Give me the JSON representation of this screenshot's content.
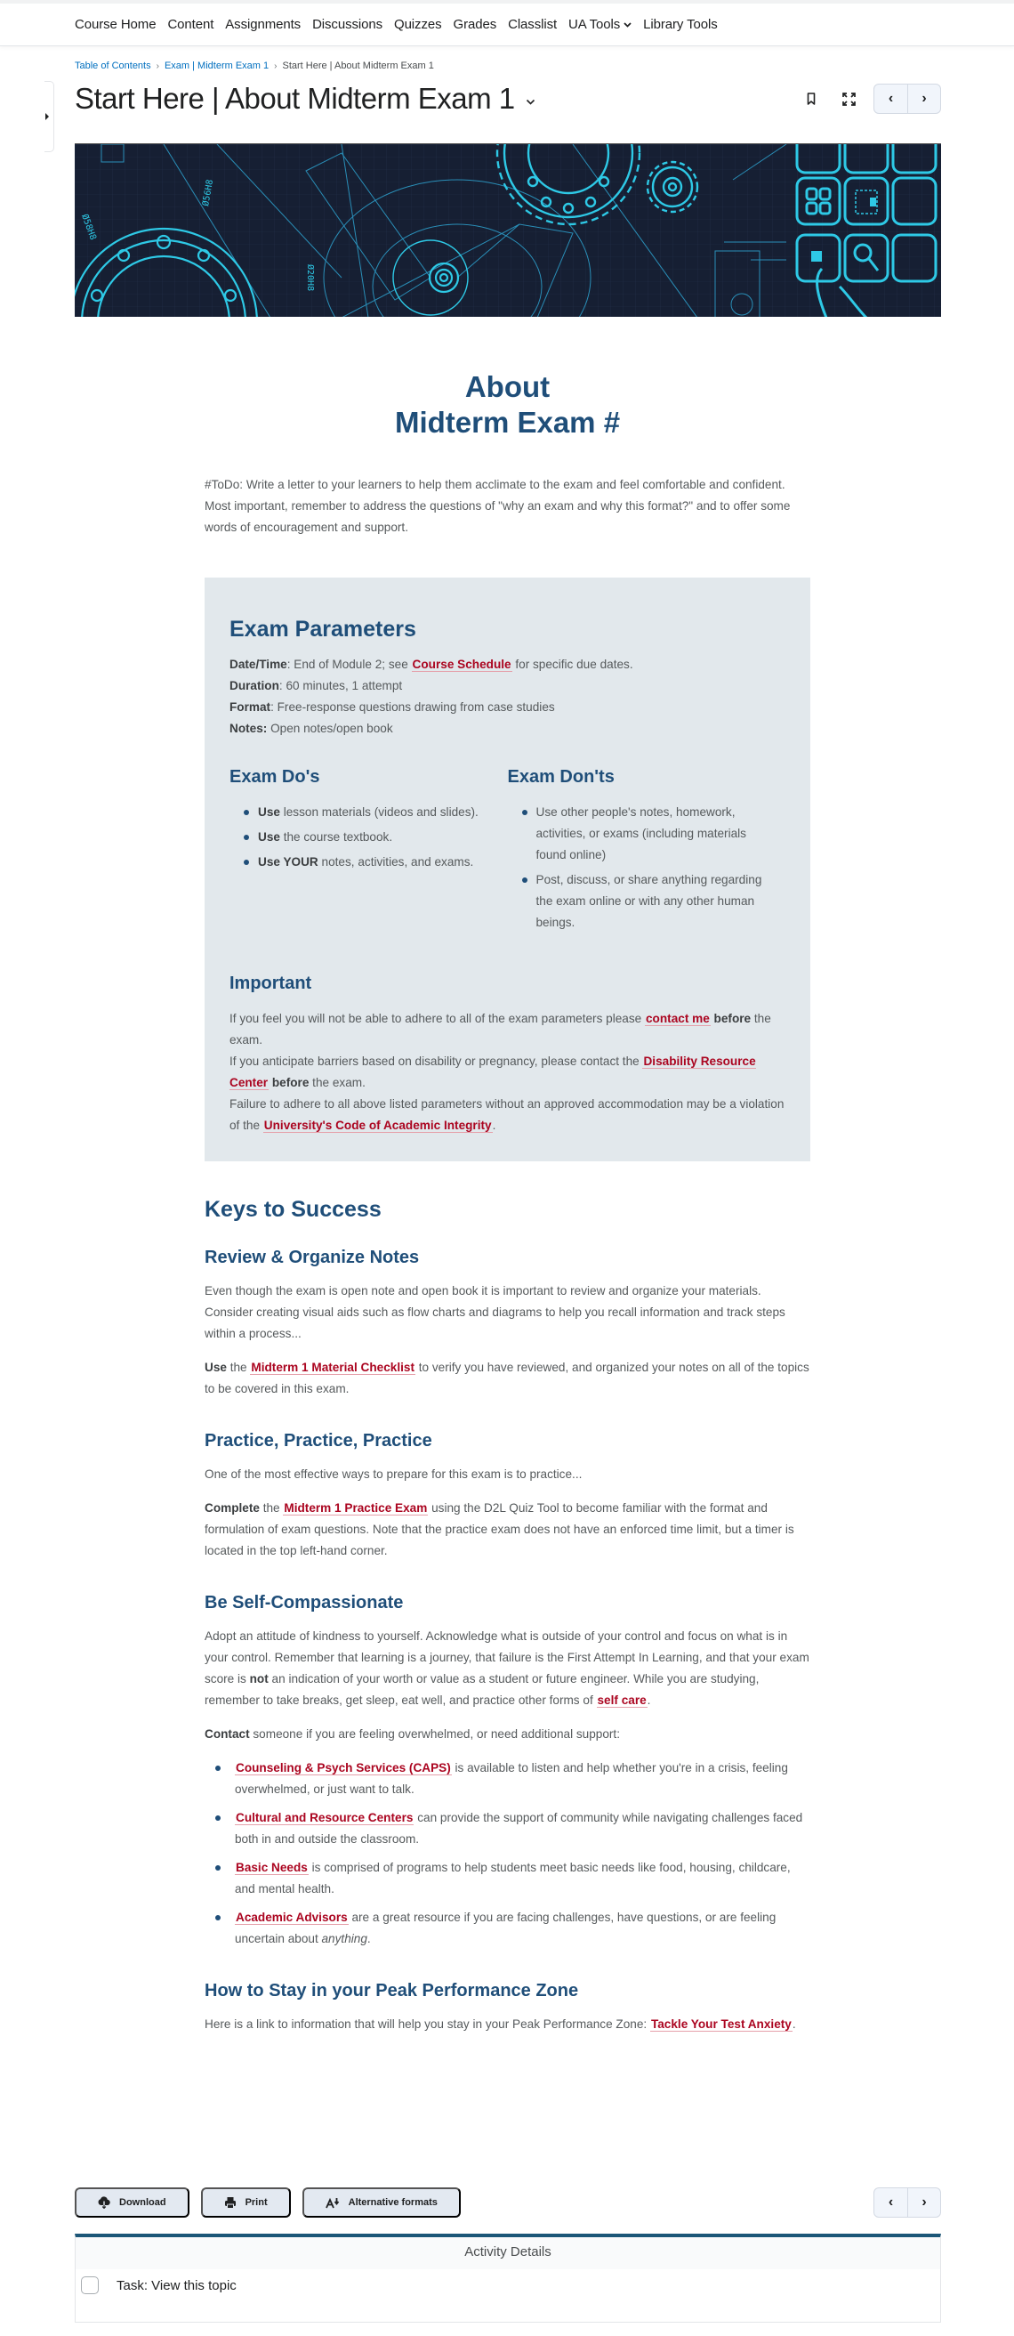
{
  "nav": {
    "items": [
      {
        "label": "Course Home"
      },
      {
        "label": "Content"
      },
      {
        "label": "Assignments"
      },
      {
        "label": "Discussions"
      },
      {
        "label": "Quizzes"
      },
      {
        "label": "Grades"
      },
      {
        "label": "Classlist"
      },
      {
        "label": "UA Tools",
        "has_dropdown": true
      },
      {
        "label": "Library Tools"
      }
    ]
  },
  "breadcrumb": {
    "items": [
      "Table of Contents",
      "Exam | Midterm Exam 1"
    ],
    "current": "Start Here | About Midterm Exam 1",
    "separator": "›"
  },
  "page": {
    "title": "Start Here | About Midterm Exam 1",
    "actions": {
      "bookmark_icon": "bookmark-icon",
      "fullscreen_icon": "expand-icon",
      "prev": "‹",
      "next": "›"
    }
  },
  "banner": {
    "description": "blueprint engineering illustration with gears and cyan icon tiles",
    "colors": {
      "background": "#161f33",
      "line": "#2ec9e6"
    },
    "labels": [
      "Ø58H8",
      "Ø56H8",
      "Ø20H8"
    ]
  },
  "article": {
    "hero_line1": "About",
    "hero_line2": "Midterm Exam #",
    "intro": "#ToDo: Write a letter to your learners to help them acclimate to the exam and feel comfortable and confident. Most important, remember to address the questions of \"why an exam and why this format?\" and to offer some words of encouragement and support.",
    "params": {
      "heading": "Exam Parameters",
      "datetime_label": "Date/Time",
      "datetime_pre": ": End of Module 2; see ",
      "datetime_link": "Course Schedule",
      "datetime_post": " for specific due dates.",
      "duration_label": "Duration",
      "duration_value": ": 60 minutes, 1 attempt",
      "format_label": "Format",
      "format_value": ": Free-response questions drawing from case studies",
      "notes_label": "Notes:",
      "notes_value": " Open notes/open book"
    },
    "dos": {
      "heading": "Exam Do's",
      "items": [
        {
          "bold": "Use",
          "text": " lesson materials (videos and slides)."
        },
        {
          "bold": "Use",
          "text": " the course textbook."
        },
        {
          "bold": "Use YOUR",
          "text": " notes, activities, and exams."
        }
      ]
    },
    "donts": {
      "heading": "Exam Don'ts",
      "items": [
        "Use other people's notes, homework, activities, or exams (including materials found online)",
        "Post, discuss, or share anything regarding the exam online or with any other human beings."
      ]
    },
    "important": {
      "heading": "Important",
      "line1_pre": "If you feel you will not be able to adhere to all of the exam parameters please ",
      "line1_link": "contact me",
      "line1_bold": "before",
      "line1_post": " the exam.",
      "line2_pre": "If you anticipate barriers based on disability or pregnancy, please contact the ",
      "line2_link": "Disability Resource Center",
      "line2_bold": "before",
      "line2_post": " the exam.",
      "line3_pre": "Failure to adhere to all above listed parameters without an approved accommodation may be a violation of the ",
      "line3_link": "University's Code of Academic Integrity",
      "line3_post": "."
    },
    "keys": {
      "heading": "Keys to Success",
      "review": {
        "heading": "Review & Organize Notes",
        "para": "Even though the exam is open note and open book it is important to review and organize your materials. Consider creating visual aids such as flow charts and diagrams to help you recall information and track steps within a process...",
        "use_bold": "Use",
        "use_pre": " the ",
        "use_link": "Midterm 1 Material Checklist",
        "use_post": " to verify you have reviewed, and organized your notes on all of the topics to be covered in this exam."
      },
      "practice": {
        "heading": "Practice, Practice, Practice",
        "para": "One of the most effective ways to prepare for this exam is to practice...",
        "complete_bold": "Complete",
        "complete_pre": " the ",
        "complete_link": "Midterm 1 Practice Exam",
        "complete_post": " using the D2L Quiz Tool to become familiar with the format and formulation of exam questions. Note that the practice exam does not have an enforced time limit, but a timer is located in the top left-hand corner."
      },
      "self": {
        "heading": "Be Self-Compassionate",
        "para_pre": "Adopt an attitude of kindness to yourself. Acknowledge what is outside of your control and focus on what is in your control. Remember that learning is a journey, that failure is the First Attempt In Learning, and that your exam score is ",
        "para_bold": "not",
        "para_mid": " an indication of your worth or value as a student or future engineer. While you are studying, remember to take breaks, get sleep, eat well, and practice other forms of ",
        "para_link": "self care",
        "para_post": ".",
        "contact_bold": "Contact",
        "contact_text": " someone if you are feeling overwhelmed, or need additional support:",
        "support": [
          {
            "link": "Counseling & Psych Services (CAPS)",
            "text": " is available to listen and help whether you're in a crisis, feeling overwhelmed, or just want to talk."
          },
          {
            "link": "Cultural and Resource Centers",
            "text": " can provide the support of community while navigating challenges faced both in and outside the classroom."
          },
          {
            "link": "Basic Needs",
            "text": " is comprised of programs to help students meet basic needs like food, housing, childcare, and mental health."
          },
          {
            "link": "Academic Advisors",
            "text": " are a great resource if you are facing challenges, have questions, or are feeling uncertain about ",
            "italic": "anything",
            "end": "."
          }
        ]
      },
      "peak": {
        "heading": "How to Stay in your Peak Performance Zone",
        "para": "Here is a link to information that will help you stay in your Peak Performance Zone: ",
        "link": "Tackle Your Test Anxiety",
        "post": "."
      }
    }
  },
  "toolbar": {
    "download": "Download",
    "print": "Print",
    "alt_formats": "Alternative formats",
    "prev": "‹",
    "next": "›"
  },
  "activity": {
    "heading": "Activity Details",
    "task": "Task: View this topic",
    "task_checked": false
  },
  "colors": {
    "heading": "#1f4e79",
    "link": "#ab0520",
    "crumb_link": "#006fbf",
    "panel": "#e2e8ec",
    "activity_border": "#1c5778"
  }
}
